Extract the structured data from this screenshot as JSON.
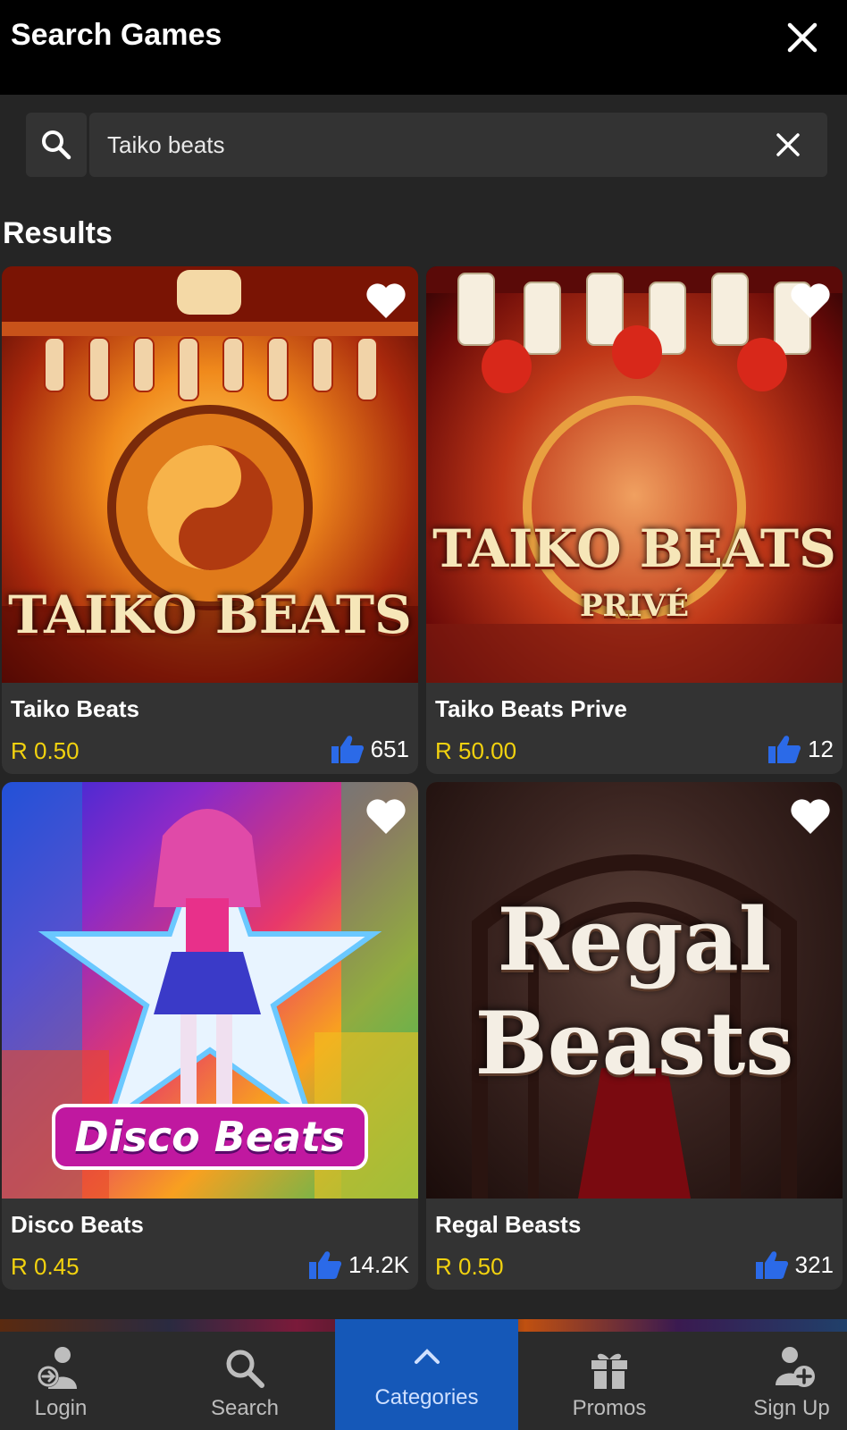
{
  "header": {
    "title": "Search Games",
    "close_icon": "close-icon"
  },
  "search": {
    "value": "Taiko beats",
    "search_icon": "search-icon",
    "clear_icon": "clear-icon"
  },
  "results_label": "Results",
  "games": [
    {
      "name": "Taiko Beats",
      "price": "R 0.50",
      "likes": "651",
      "art_title": "TAIKO BEATS",
      "art_subtitle": ""
    },
    {
      "name": "Taiko Beats Prive",
      "price": "R 50.00",
      "likes": "12",
      "art_title": "TAIKO BEATS",
      "art_subtitle": "PRIVÉ"
    },
    {
      "name": "Disco Beats",
      "price": "R 0.45",
      "likes": "14.2K",
      "art_title": "Disco Beats",
      "art_subtitle": ""
    },
    {
      "name": "Regal Beasts",
      "price": "R 0.50",
      "likes": "321",
      "art_title": "Regal",
      "art_subtitle": "Beasts"
    }
  ],
  "nav": [
    {
      "label": "Login",
      "icon": "login-icon"
    },
    {
      "label": "Search",
      "icon": "search-icon"
    },
    {
      "label": "Categories",
      "icon": "chevron-up-icon"
    },
    {
      "label": "Promos",
      "icon": "gift-icon"
    },
    {
      "label": "Sign Up",
      "icon": "add-user-icon"
    }
  ],
  "colors": {
    "price": "#f2d20f",
    "like": "#2b6ae8",
    "active_nav": "#1558b8",
    "background": "#252525"
  }
}
